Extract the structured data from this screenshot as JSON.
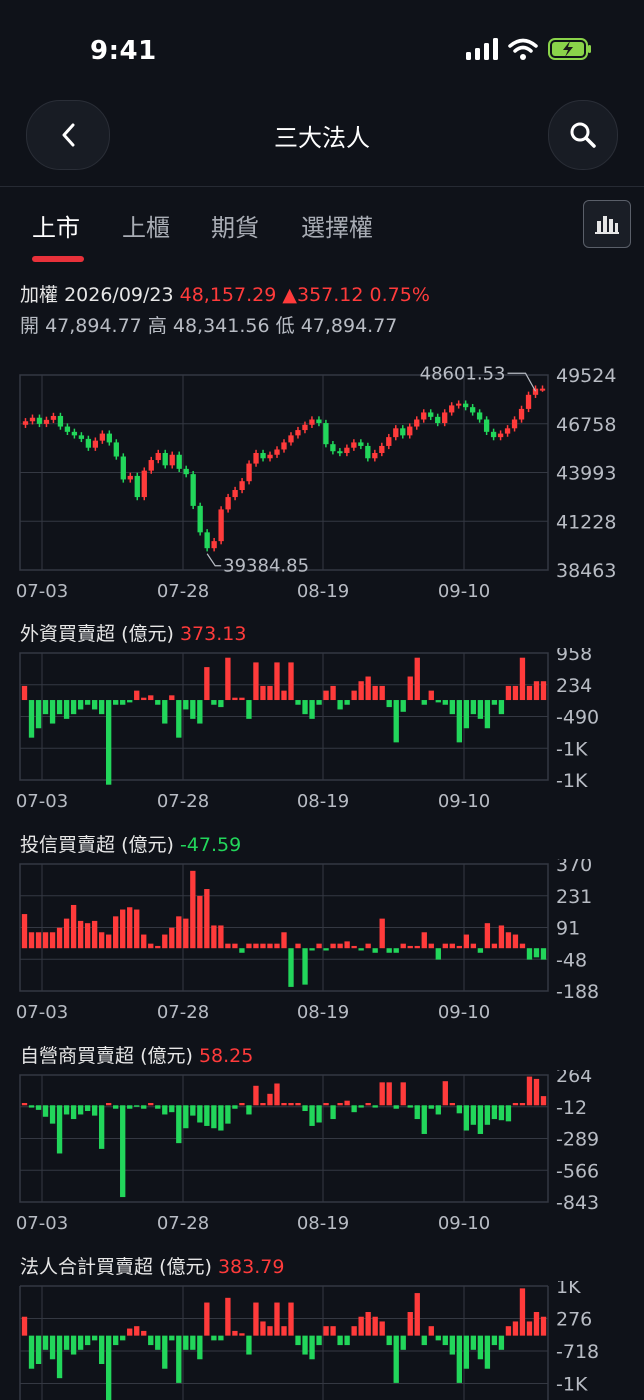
{
  "status_bar": {
    "time": "9:41",
    "icons": [
      "signal-icon",
      "wifi-icon",
      "battery-charging-icon"
    ]
  },
  "nav": {
    "title": "三大法人",
    "back_icon": "chevron-left-icon",
    "search_icon": "search-icon"
  },
  "tabs": [
    {
      "label": "上市",
      "active": true
    },
    {
      "label": "上櫃",
      "active": false
    },
    {
      "label": "期貨",
      "active": false
    },
    {
      "label": "選擇權",
      "active": false
    }
  ],
  "chart_toggle_icon": "bar-chart-icon",
  "quote": {
    "name": "加權",
    "date": "2026/09/23",
    "price": "48,157.29",
    "change": "▲357.12",
    "pct": "0.75%",
    "open_label": "開",
    "open": "47,894.77",
    "high_label": "高",
    "high": "48,341.56",
    "low_label": "低",
    "low": "47,894.77"
  },
  "colors": {
    "up": "#ff3b3b",
    "down": "#22d65b",
    "grid": "#343842",
    "text": "#b8bcc4"
  },
  "chart_data": [
    {
      "type": "candlestick",
      "x_tick_labels": [
        "07-03",
        "07-28",
        "08-19",
        "09-10"
      ],
      "y_tick_labels": [
        "49524",
        "46758",
        "43993",
        "41228",
        "38463"
      ],
      "ylim": [
        38463,
        49524
      ],
      "annotations": [
        {
          "label": "48601.53",
          "value": 48601.53
        },
        {
          "label": "39384.85",
          "value": 39384.85
        }
      ],
      "closes": [
        46900,
        47100,
        46750,
        46980,
        47200,
        46600,
        46300,
        46100,
        45900,
        45400,
        45800,
        46200,
        45700,
        44900,
        43600,
        43800,
        42600,
        44100,
        44700,
        45100,
        44400,
        45000,
        44200,
        43900,
        42100,
        40600,
        39700,
        40100,
        41900,
        42600,
        43000,
        43500,
        44500,
        45100,
        44800,
        45000,
        45300,
        45700,
        46100,
        46400,
        46700,
        47000,
        46800,
        45600,
        45200,
        45100,
        45400,
        45700,
        45500,
        44800,
        45100,
        45500,
        46000,
        46500,
        46100,
        46600,
        47000,
        47400,
        47150,
        46800,
        47400,
        47800,
        47900,
        47700,
        47400,
        47000,
        46300,
        46000,
        46200,
        46500,
        47000,
        47600,
        48400,
        48750,
        48750
      ]
    },
    {
      "type": "bar",
      "title": "外資買賣超",
      "unit_label": "(億元)",
      "latest": "373.13",
      "latest_dir": "up",
      "x_tick_labels": [
        "07-03",
        "07-28",
        "08-19",
        "09-10"
      ],
      "y_tick_labels": [
        "958",
        "234",
        "-490",
        "-1K",
        "-1K"
      ],
      "ylim": [
        -1700,
        1000
      ],
      "values": [
        300,
        -800,
        -600,
        -300,
        -500,
        -300,
        -400,
        -300,
        -200,
        -100,
        -200,
        -300,
        -1800,
        -100,
        -100,
        -50,
        200,
        50,
        100,
        -100,
        -500,
        100,
        -800,
        -200,
        -400,
        -500,
        700,
        -100,
        -150,
        900,
        50,
        50,
        -400,
        800,
        300,
        300,
        800,
        200,
        800,
        -100,
        -300,
        -400,
        -100,
        200,
        300,
        -200,
        -100,
        200,
        400,
        500,
        300,
        300,
        -150,
        -900,
        -250,
        500,
        900,
        -100,
        200,
        -50,
        -100,
        -300,
        -900,
        -600,
        -300,
        -400,
        -600,
        -100,
        -300,
        300,
        300,
        900,
        300,
        400,
        400
      ]
    },
    {
      "type": "bar",
      "title": "投信買賣超",
      "unit_label": "(億元)",
      "latest": "-47.59",
      "latest_dir": "down",
      "x_tick_labels": [
        "07-03",
        "07-28",
        "08-19",
        "09-10"
      ],
      "y_tick_labels": [
        "370",
        "231",
        "91",
        "-48",
        "-188"
      ],
      "ylim": [
        -188,
        370
      ],
      "values": [
        150,
        70,
        70,
        70,
        70,
        90,
        130,
        190,
        120,
        110,
        120,
        70,
        60,
        140,
        170,
        180,
        170,
        60,
        20,
        10,
        60,
        90,
        140,
        130,
        340,
        230,
        260,
        100,
        100,
        20,
        20,
        -20,
        20,
        20,
        20,
        20,
        20,
        70,
        -170,
        20,
        -160,
        -10,
        20,
        -10,
        20,
        20,
        30,
        10,
        -10,
        20,
        -20,
        130,
        -20,
        -20,
        20,
        10,
        10,
        70,
        20,
        -50,
        20,
        20,
        10,
        60,
        20,
        -20,
        110,
        20,
        100,
        70,
        60,
        20,
        -50,
        -40,
        -50
      ]
    },
    {
      "type": "bar",
      "title": "自營商買賣超",
      "unit_label": "(億元)",
      "latest": "58.25",
      "latest_dir": "up",
      "x_tick_labels": [
        "07-03",
        "07-28",
        "08-19",
        "09-10"
      ],
      "y_tick_labels": [
        "264",
        "-12",
        "-289",
        "-566",
        "-843"
      ],
      "ylim": [
        -843,
        264
      ],
      "values": [
        20,
        -20,
        -40,
        -100,
        -160,
        -420,
        -80,
        -120,
        -80,
        -50,
        -90,
        -380,
        20,
        -30,
        -800,
        -30,
        -10,
        -30,
        20,
        -30,
        -80,
        -60,
        -330,
        -200,
        -90,
        -150,
        -180,
        -200,
        -220,
        -160,
        -30,
        20,
        -80,
        170,
        20,
        100,
        190,
        20,
        20,
        20,
        -50,
        -180,
        -150,
        20,
        -120,
        20,
        40,
        -60,
        -20,
        20,
        -20,
        200,
        200,
        -30,
        200,
        -20,
        -120,
        -250,
        -30,
        -80,
        210,
        20,
        -70,
        -220,
        -170,
        -250,
        -170,
        -120,
        -130,
        -140,
        20,
        20,
        250,
        230,
        80
      ]
    },
    {
      "type": "bar",
      "title": "法人合計買賣超",
      "unit_label": "(億元)",
      "latest": "383.79",
      "latest_dir": "up",
      "x_tick_labels": [
        "07-03",
        "07-28",
        "08-19",
        "09-10"
      ],
      "y_tick_labels": [
        "1K",
        "276",
        "-718",
        "-1K"
      ],
      "ylim": [
        -1700,
        1050
      ],
      "values": [
        400,
        -700,
        -600,
        -300,
        -500,
        -900,
        -300,
        -400,
        -300,
        -200,
        -100,
        -600,
        -1800,
        -200,
        -100,
        150,
        200,
        100,
        -200,
        -300,
        -700,
        -100,
        -1000,
        -300,
        -300,
        -500,
        700,
        -100,
        -100,
        800,
        100,
        50,
        -400,
        700,
        300,
        200,
        700,
        200,
        700,
        -200,
        -400,
        -500,
        -200,
        200,
        200,
        -200,
        -200,
        200,
        400,
        500,
        400,
        300,
        -200,
        -1000,
        -300,
        500,
        900,
        -200,
        200,
        -100,
        -200,
        -400,
        -1000,
        -700,
        -300,
        -500,
        -700,
        -200,
        -300,
        200,
        300,
        1000,
        300,
        500,
        400
      ]
    }
  ]
}
